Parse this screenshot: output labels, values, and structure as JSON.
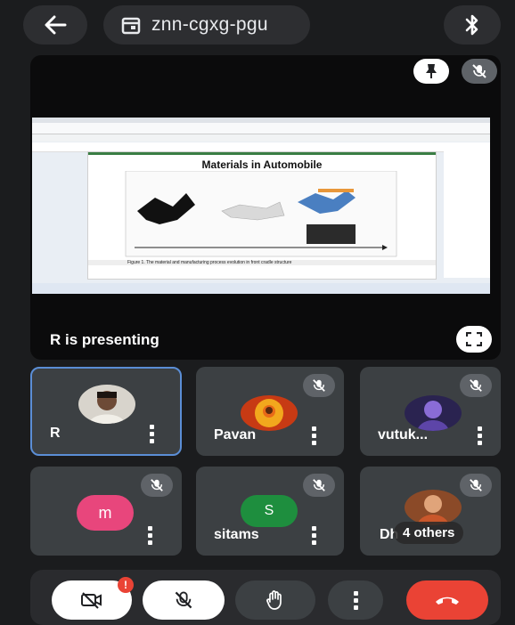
{
  "topbar": {
    "meeting_code": "znn-cgxg-pgu"
  },
  "main_tile": {
    "presenting_label": "R is presenting"
  },
  "slide": {
    "title": "Materials in Automobile",
    "caption": "Figure 1. The material and manufacturing process evolution in front cradle structure"
  },
  "participants": [
    {
      "name": "R"
    },
    {
      "name": "Pavan"
    },
    {
      "name": "vutuk..."
    },
    {
      "name": "",
      "initial": "m",
      "color": "#e8467c"
    },
    {
      "name": "sitams",
      "initial": "S",
      "color": "#1e8e3e"
    },
    {
      "name": "Dh",
      "others_label": "4 others"
    }
  ],
  "controls": {
    "camera_badge": "!"
  },
  "colors": {
    "end_call": "#ea4335",
    "tile_bg": "#3c4043",
    "bar_bg": "#2d2e31"
  }
}
